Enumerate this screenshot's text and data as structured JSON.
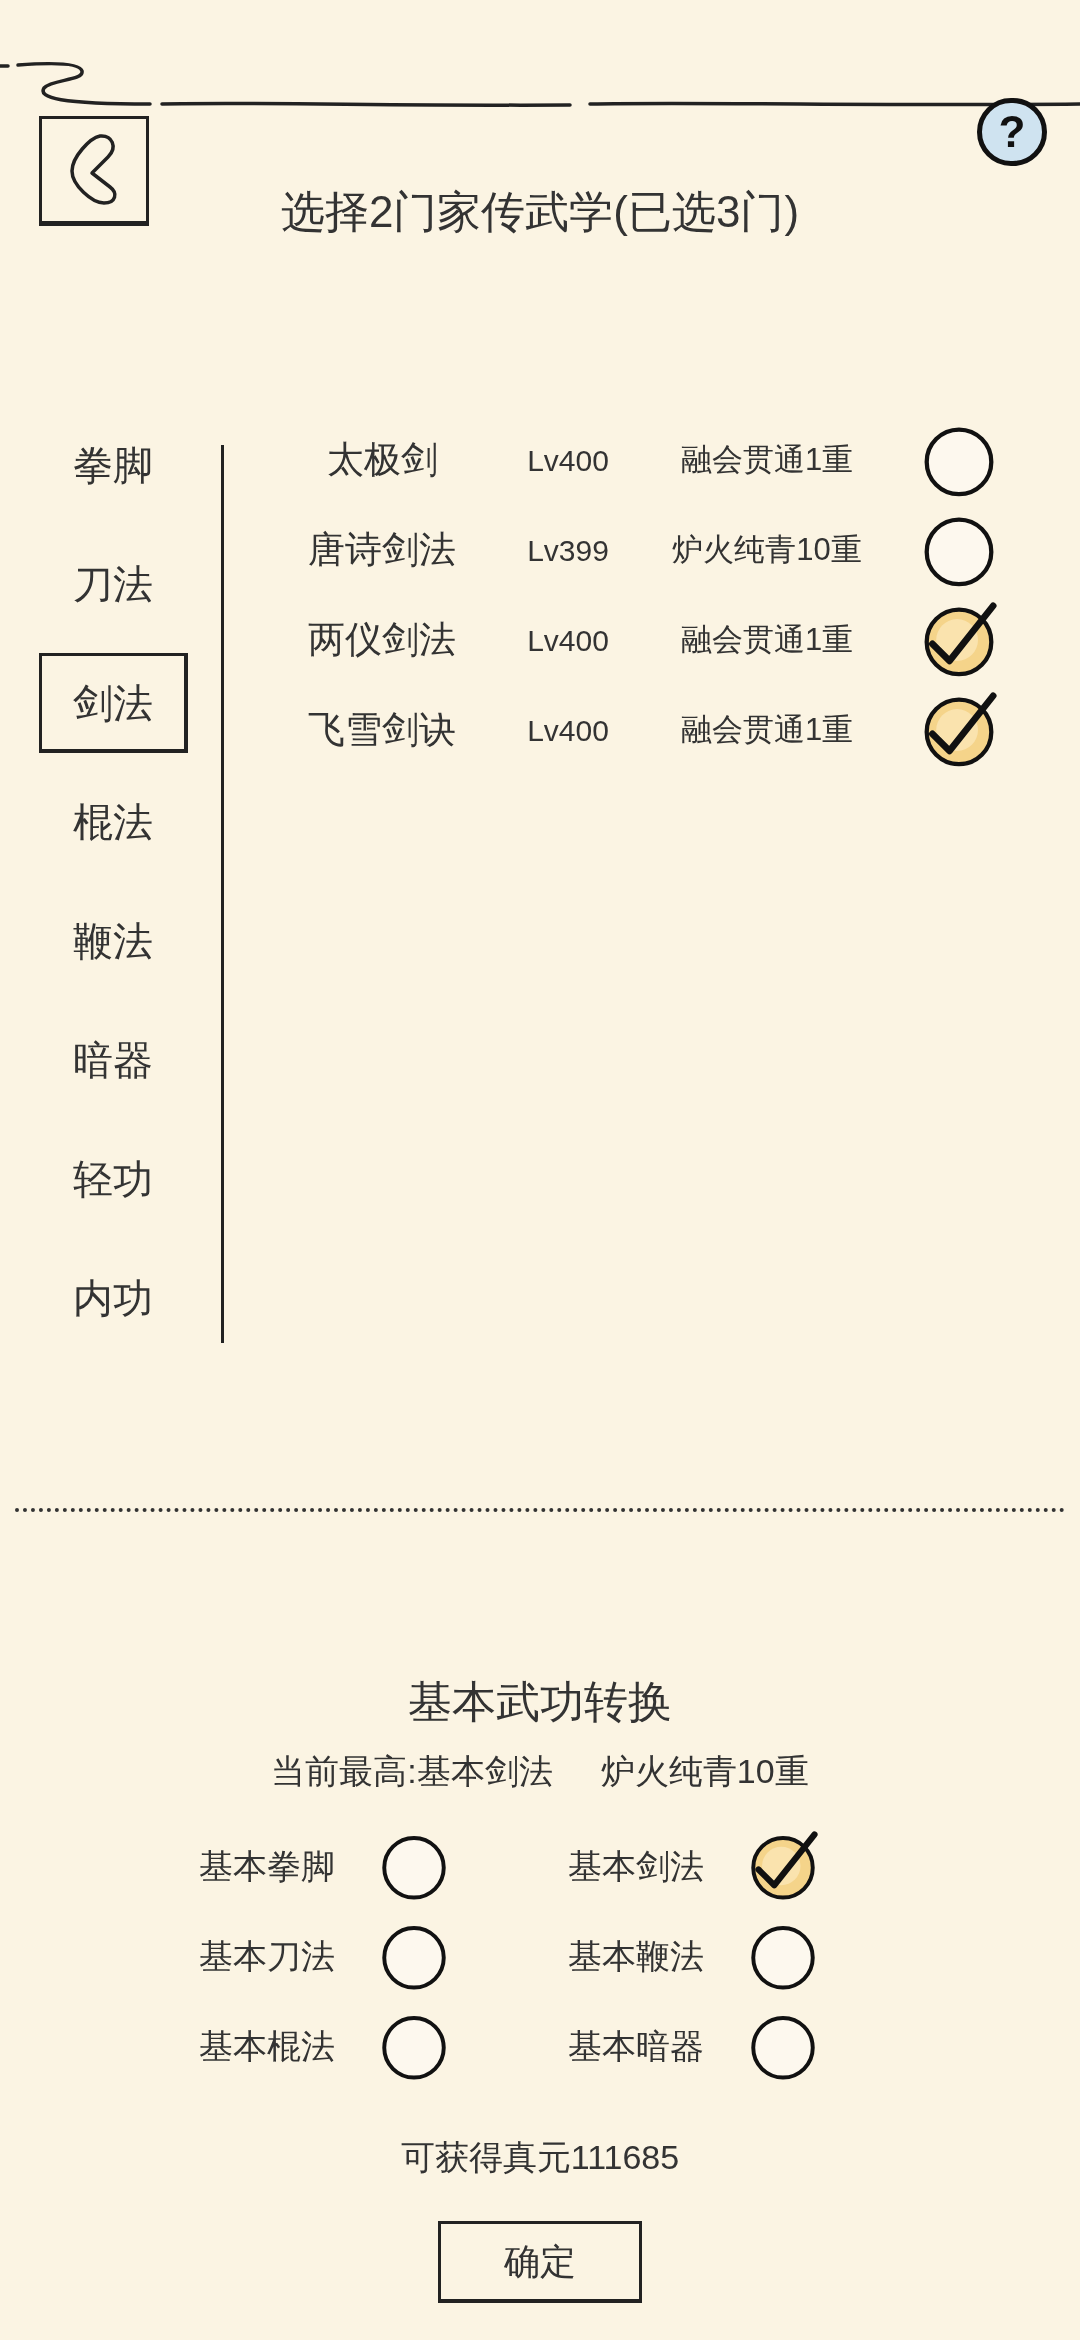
{
  "header": {
    "help": "?",
    "title": "选择2门家传武学(已选3门)"
  },
  "categories": [
    {
      "label": "拳脚",
      "selected": false
    },
    {
      "label": "刀法",
      "selected": false
    },
    {
      "label": "剑法",
      "selected": true
    },
    {
      "label": "棍法",
      "selected": false
    },
    {
      "label": "鞭法",
      "selected": false
    },
    {
      "label": "暗器",
      "selected": false
    },
    {
      "label": "轻功",
      "selected": false
    },
    {
      "label": "内功",
      "selected": false
    }
  ],
  "skills": [
    {
      "name": "太极剑",
      "lv": "Lv400",
      "realm": "融会贯通1重",
      "checked": false
    },
    {
      "name": "唐诗剑法",
      "lv": "Lv399",
      "realm": "炉火纯青10重",
      "checked": false
    },
    {
      "name": "两仪剑法",
      "lv": "Lv400",
      "realm": "融会贯通1重",
      "checked": true
    },
    {
      "name": "飞雪剑诀",
      "lv": "Lv400",
      "realm": "融会贯通1重",
      "checked": true
    }
  ],
  "conversion": {
    "title": "基本武功转换",
    "current": "当前最高:基本剑法",
    "current_realm": "炉火纯青10重",
    "options": [
      {
        "label": "基本拳脚",
        "checked": false
      },
      {
        "label": "基本剑法",
        "checked": true
      },
      {
        "label": "基本刀法",
        "checked": false
      },
      {
        "label": "基本鞭法",
        "checked": false
      },
      {
        "label": "基本棍法",
        "checked": false
      },
      {
        "label": "基本暗器",
        "checked": false
      }
    ],
    "reward": "可获得真元111685",
    "confirm": "确定"
  }
}
